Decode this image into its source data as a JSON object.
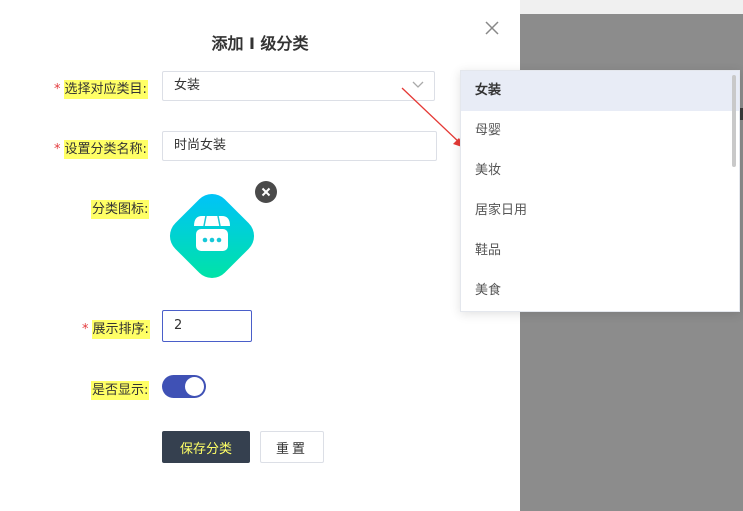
{
  "dialog": {
    "title": "添加 I 级分类"
  },
  "form": {
    "category_label": "选择对应类目:",
    "category_value": "女装",
    "name_label": "设置分类名称:",
    "name_value": "时尚女装",
    "icon_label": "分类图标:",
    "order_label": "展示排序:",
    "order_value": "2",
    "show_label": "是否显示:",
    "show_on": true,
    "required_mark": "*"
  },
  "buttons": {
    "save": "保存分类",
    "reset": "重置"
  },
  "dropdown": {
    "items": [
      {
        "label": "女装",
        "selected": true
      },
      {
        "label": "母婴",
        "selected": false
      },
      {
        "label": "美妆",
        "selected": false
      },
      {
        "label": "居家日用",
        "selected": false
      },
      {
        "label": "鞋品",
        "selected": false
      },
      {
        "label": "美食",
        "selected": false
      }
    ]
  },
  "colors": {
    "primary": "#3f51b5",
    "save_bg": "#35404f",
    "highlight": "#ffff66",
    "required": "#e4393c",
    "icon_gradient_start": "#00c6ff",
    "icon_gradient_end": "#00e3a0"
  },
  "icons": {
    "close": "close-icon",
    "chevron": "chevron-down-icon",
    "store": "store-icon",
    "remove": "remove-icon"
  }
}
